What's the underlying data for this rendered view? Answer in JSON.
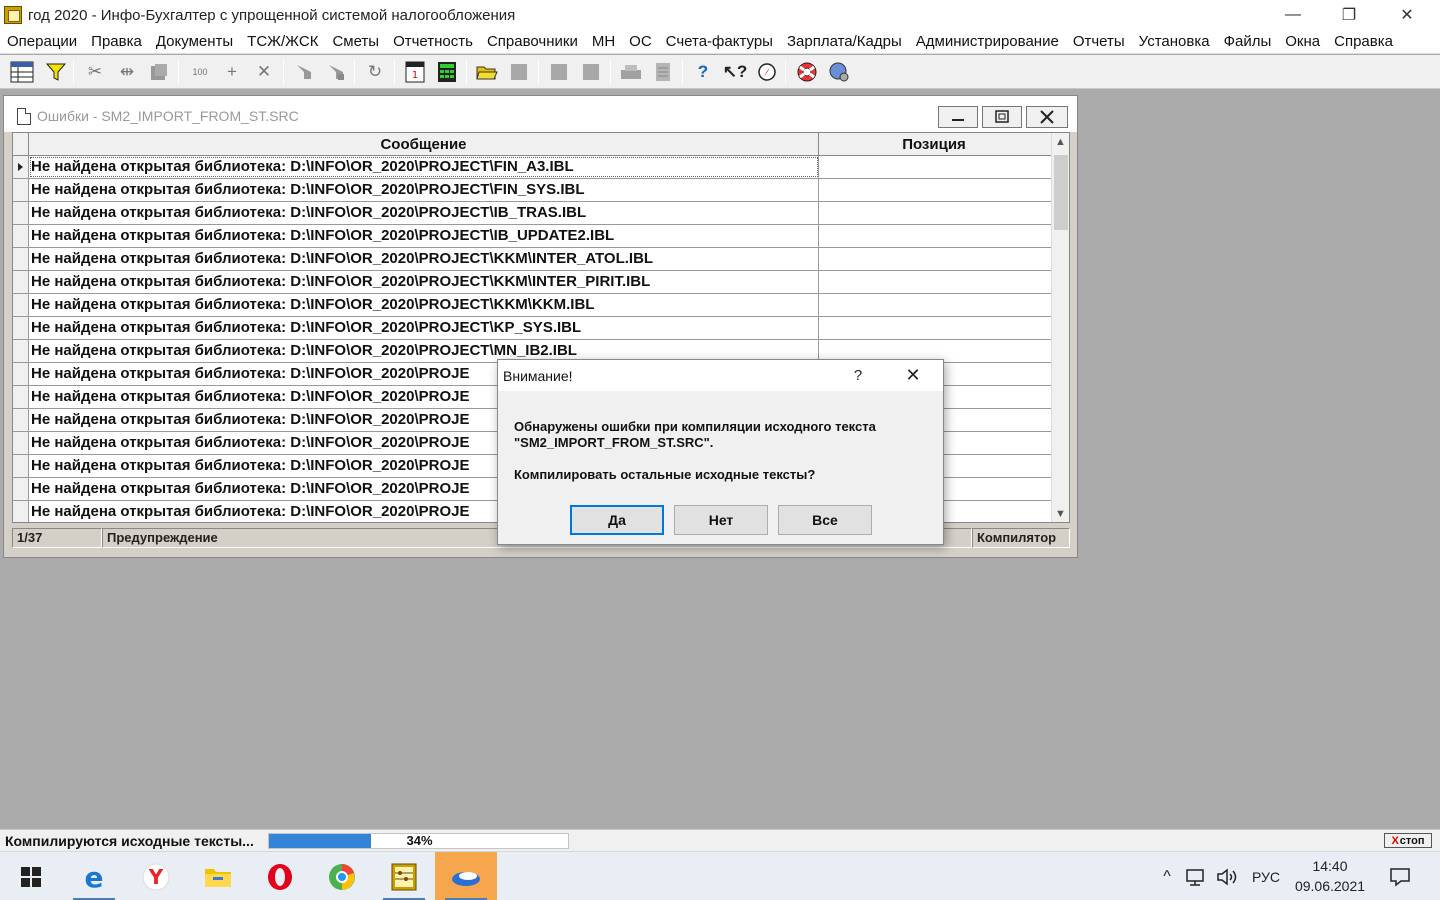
{
  "app": {
    "title": "год 2020 - Инфо-Бухгалтер с упрощенной системой налогообложения",
    "minimize_glyph": "—",
    "restore_glyph": "❐",
    "close_glyph": "✕"
  },
  "menu": [
    "Операции",
    "Правка",
    "Документы",
    "ТСЖ/ЖСК",
    "Сметы",
    "Отчетность",
    "Справочники",
    "МН",
    "ОС",
    "Счета-фактуры",
    "Зарплата/Кадры",
    "Администрирование",
    "Отчеты",
    "Установка",
    "Файлы",
    "Окна",
    "Справка"
  ],
  "toolbar": {
    "icons": [
      "table-view-icon",
      "filter-icon",
      "cut-icon",
      "split-icon",
      "paste-icon",
      "number-icon",
      "add-icon",
      "delete-icon",
      "tool-icon",
      "tool2-icon",
      "refresh-icon",
      "calendar-icon",
      "calculator-icon",
      "open-folder-icon",
      "disabled-icon",
      "disabled2-icon",
      "disabled3-icon",
      "print-icon",
      "print-preview-icon",
      "help-icon",
      "context-help-icon",
      "compass-icon",
      "lifebuoy-icon",
      "web-icon"
    ],
    "number_label": "100"
  },
  "errors_window": {
    "title": "Ошибки - SM2_IMPORT_FROM_ST.SRC",
    "columns": {
      "message": "Сообщение",
      "position": "Позиция"
    },
    "rows": [
      "Не найдена открытая библиотека: D:\\INFO\\OR_2020\\PROJECT\\FIN_A3.IBL",
      "Не найдена открытая библиотека: D:\\INFO\\OR_2020\\PROJECT\\FIN_SYS.IBL",
      "Не найдена открытая библиотека: D:\\INFO\\OR_2020\\PROJECT\\IB_TRAS.IBL",
      "Не найдена открытая библиотека: D:\\INFO\\OR_2020\\PROJECT\\IB_UPDATE2.IBL",
      "Не найдена открытая библиотека: D:\\INFO\\OR_2020\\PROJECT\\KKM\\INTER_ATOL.IBL",
      "Не найдена открытая библиотека: D:\\INFO\\OR_2020\\PROJECT\\KKM\\INTER_PIRIT.IBL",
      "Не найдена открытая библиотека: D:\\INFO\\OR_2020\\PROJECT\\KKM\\KKM.IBL",
      "Не найдена открытая библиотека: D:\\INFO\\OR_2020\\PROJECT\\KP_SYS.IBL",
      "Не найдена открытая библиотека: D:\\INFO\\OR_2020\\PROJECT\\MN_IB2.IBL",
      "Не найдена открытая библиотека: D:\\INFO\\OR_2020\\PROJE",
      "Не найдена открытая библиотека: D:\\INFO\\OR_2020\\PROJE",
      "Не найдена открытая библиотека: D:\\INFO\\OR_2020\\PROJE",
      "Не найдена открытая библиотека: D:\\INFO\\OR_2020\\PROJE",
      "Не найдена открытая библиотека: D:\\INFO\\OR_2020\\PROJE",
      "Не найдена открытая библиотека: D:\\INFO\\OR_2020\\PROJE",
      "Не найдена открытая библиотека: D:\\INFO\\OR_2020\\PROJE"
    ],
    "status": {
      "counter": "1/37",
      "type": "Предупреждение",
      "source": "Компилятор"
    }
  },
  "dialog": {
    "title": "Внимание!",
    "help_glyph": "?",
    "close_glyph": "✕",
    "line1": "Обнаружены ошибки при компиляции исходного текста",
    "line2": "\"SM2_IMPORT_FROM_ST.SRC\".",
    "question": "Компилировать остальные исходные тексты?",
    "buttons": {
      "yes": "Да",
      "no": "Нет",
      "all": "Все"
    }
  },
  "app_status": {
    "text": "Компилируются исходные тексты...",
    "progress_percent": 34,
    "progress_label": "34%",
    "stop_label": "стоп",
    "stop_x": "X"
  },
  "taskbar": {
    "apps": [
      "windows-start-icon",
      "edge-icon",
      "yandex-browser-icon",
      "file-explorer-icon",
      "opera-icon",
      "chrome-like-icon",
      "abacus-app-icon",
      "info-accountant-icon"
    ],
    "tray": {
      "chevron": "^",
      "lang": "РУС"
    },
    "time": "14:40",
    "date": "09.06.2021"
  },
  "colors": {
    "accent": "#0078d7",
    "progress": "#3383d8",
    "taskbar_active": "#f6a64c",
    "workspace": "#ababab"
  }
}
